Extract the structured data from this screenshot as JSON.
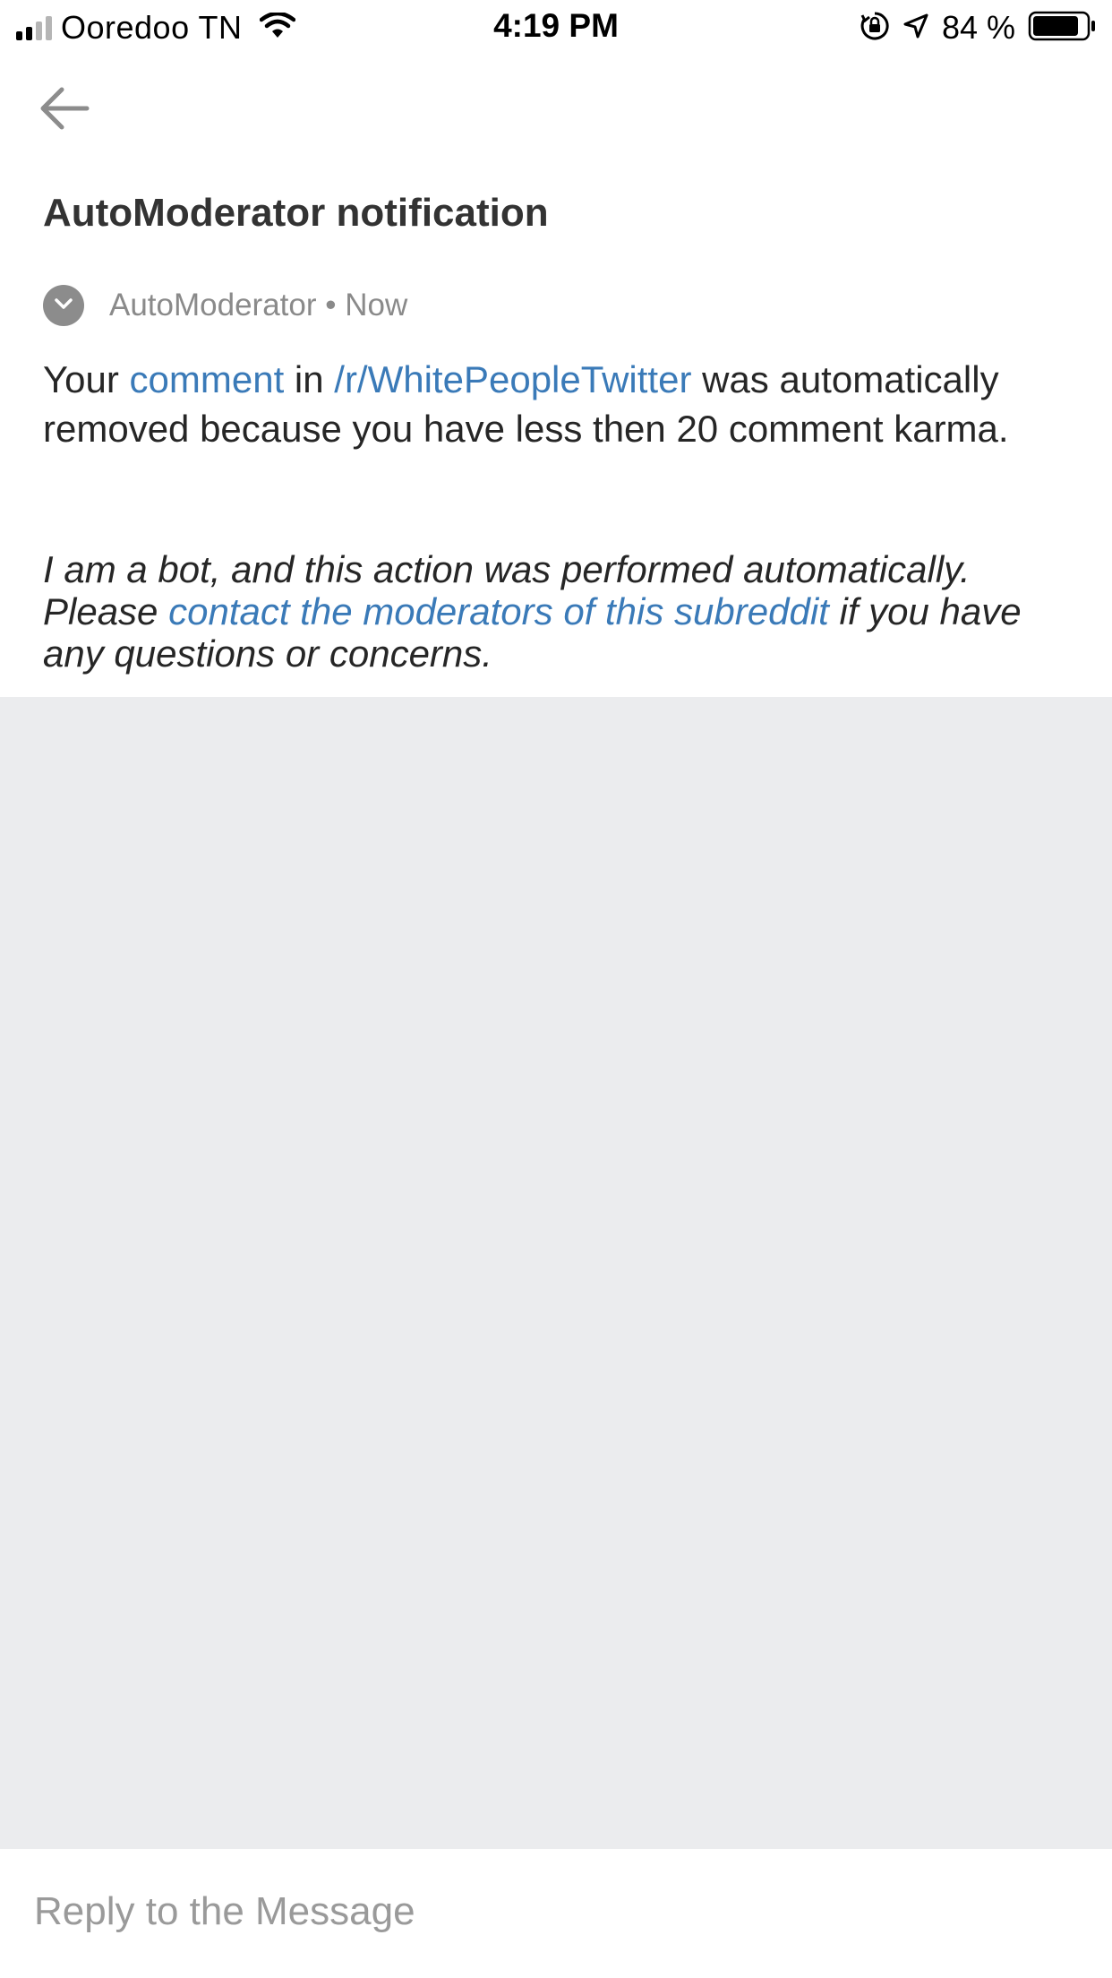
{
  "status_bar": {
    "carrier": "Ooredoo TN",
    "time": "4:19 PM",
    "battery_percent": "84 %",
    "icons": [
      "signal-icon",
      "wifi-icon",
      "orientation-lock-icon",
      "location-icon",
      "battery-icon"
    ]
  },
  "header": {
    "back_icon": "arrow-left-icon",
    "title": "AutoModerator notification"
  },
  "message": {
    "author": "AutoModerator",
    "separator": " • ",
    "time": "Now",
    "avatar_icon": "chevron-down-icon",
    "body": {
      "part1": "Your ",
      "link1": "comment",
      "part2": " in ",
      "link2": "/r/WhitePeopleTwitter",
      "part3": " was automatically removed because you have less then 20 comment karma."
    },
    "note": {
      "part1": "I am a bot, and this action was performed automatically. Please ",
      "link": "contact the moderators of this subreddit",
      "part2": " if you have any questions or concerns."
    }
  },
  "reply": {
    "placeholder": "Reply to the Message",
    "value": ""
  },
  "colors": {
    "link": "#3a7ab8",
    "background_gray": "#ebecee",
    "meta_gray": "#8a8a8a"
  }
}
